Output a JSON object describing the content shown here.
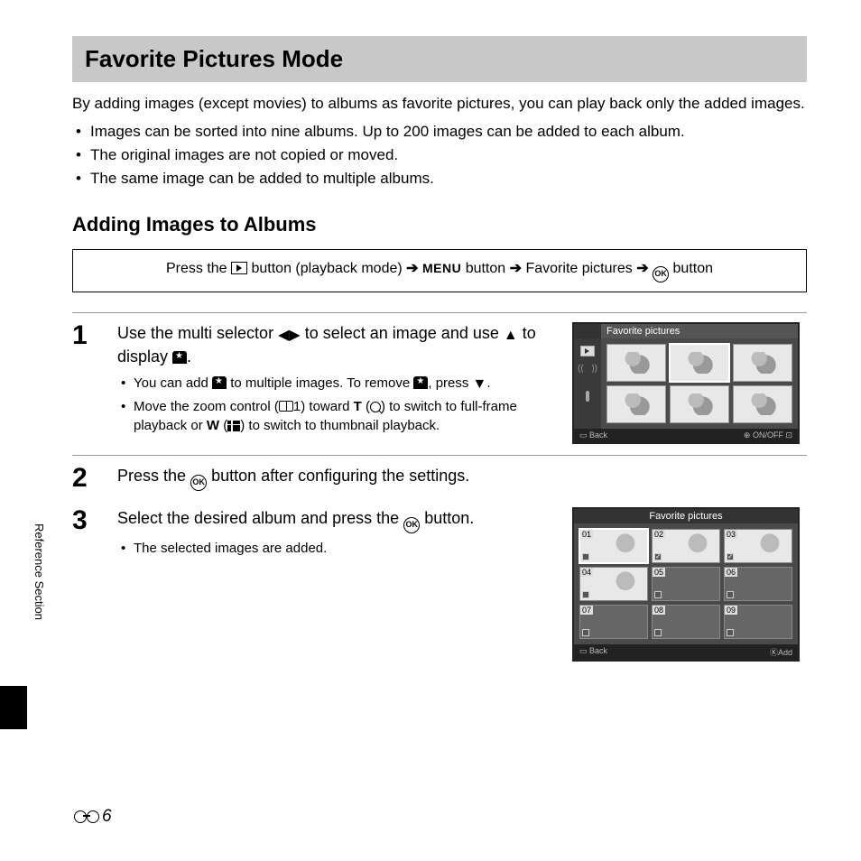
{
  "title": "Favorite Pictures Mode",
  "intro": "By adding images (except movies) to albums as favorite pictures, you can play back only the added images.",
  "bullets": [
    "Images can be sorted into nine albums. Up to 200 images can be added to each album.",
    "The original images are not copied or moved.",
    "The same image can be added to multiple albums."
  ],
  "subheading": "Adding Images to Albums",
  "nav": {
    "press_the": "Press the",
    "playback_mode": "button (playback mode)",
    "menu": "MENU",
    "button": "button",
    "favorite": "Favorite pictures"
  },
  "steps": {
    "s1": {
      "num": "1",
      "title_a": "Use the multi selector",
      "title_b": "to select an image and use",
      "title_c": "to display",
      "b1a": "You can add",
      "b1b": "to multiple images. To remove",
      "b1c": ", press",
      "b2a": "Move the zoom control (",
      "b2b": "1) toward",
      "b2c": "T",
      "b2d": ") to switch to full-frame playback or",
      "b2e": "W",
      "b2f": ") to switch to thumbnail playback."
    },
    "s2": {
      "num": "2",
      "title_a": "Press the",
      "title_b": "button after configuring the settings."
    },
    "s3": {
      "num": "3",
      "title_a": "Select the desired album and press the",
      "title_b": "button.",
      "b1": "The selected images are added."
    }
  },
  "screen1": {
    "header": "Favorite pictures",
    "foot_left": "Back",
    "foot_right": "ON/OFF"
  },
  "screen2": {
    "header": "Favorite pictures",
    "albums": [
      "01",
      "02",
      "03",
      "04",
      "05",
      "06",
      "07",
      "08",
      "09"
    ],
    "foot_left": "Back",
    "foot_right": "Add"
  },
  "side_label": "Reference Section",
  "page_number": "6"
}
